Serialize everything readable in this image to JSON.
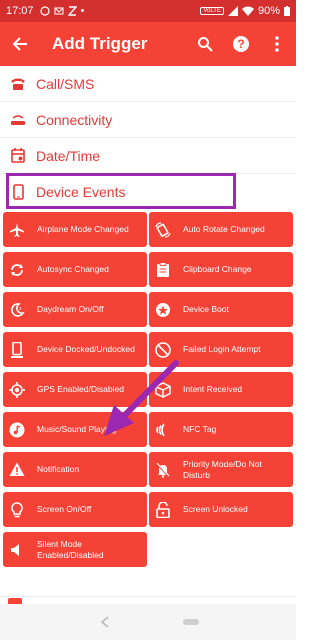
{
  "status": {
    "time": "17:07",
    "battery": "90%",
    "network": "VoLTE"
  },
  "appbar": {
    "title": "Add Trigger"
  },
  "categories": [
    {
      "label": "Call/SMS",
      "icon": "phone-icon"
    },
    {
      "label": "Connectivity",
      "icon": "router-icon"
    },
    {
      "label": "Date/Time",
      "icon": "calendar-icon"
    },
    {
      "label": "Device Events",
      "icon": "smartphone-icon"
    }
  ],
  "triggers": [
    {
      "label": "Airplane Mode Changed",
      "icon": "airplane-icon"
    },
    {
      "label": "Auto Rotate Changed",
      "icon": "rotate-icon"
    },
    {
      "label": "Autosync Changed",
      "icon": "sync-icon"
    },
    {
      "label": "Clipboard Change",
      "icon": "clipboard-icon"
    },
    {
      "label": "Daydream On/Off",
      "icon": "moon-icon"
    },
    {
      "label": "Device Boot",
      "icon": "boot-icon"
    },
    {
      "label": "Device Docked/Undocked",
      "icon": "phone-dock-icon"
    },
    {
      "label": "Failed Login Attempt",
      "icon": "lock-fail-icon"
    },
    {
      "label": "GPS Enabled/Disabled",
      "icon": "gps-icon"
    },
    {
      "label": "Intent Received",
      "icon": "cube-icon"
    },
    {
      "label": "Music/Sound Playing",
      "icon": "music-icon"
    },
    {
      "label": "NFC Tag",
      "icon": "nfc-icon"
    },
    {
      "label": "Notification",
      "icon": "warning-icon"
    },
    {
      "label": "Priority Mode/Do Not Disturb",
      "icon": "bell-off-icon"
    },
    {
      "label": "Screen On/Off",
      "icon": "bulb-icon"
    },
    {
      "label": "Screen Unlocked",
      "icon": "unlock-icon"
    },
    {
      "label": "Silent Mode Enabled/Disabled",
      "icon": "speaker-icon"
    }
  ],
  "colors": {
    "primary": "#f44336",
    "status": "#d32f2f",
    "highlight": "#9c27b0",
    "text_red": "#e53935"
  }
}
